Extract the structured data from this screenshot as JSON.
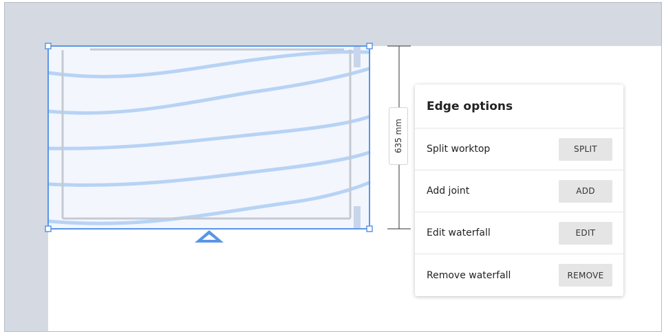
{
  "colors": {
    "wall": "#d5d9e1",
    "selection": "#5a96e6",
    "grain": "#b7d3f5",
    "button_bg": "#e5e5e5"
  },
  "dimension": {
    "label": "635 mm"
  },
  "edge_options": {
    "title": "Edge options",
    "rows": [
      {
        "label": "Split worktop",
        "button": "SPLIT"
      },
      {
        "label": "Add joint",
        "button": "ADD"
      },
      {
        "label": "Edit waterfall",
        "button": "EDIT"
      },
      {
        "label": "Remove waterfall",
        "button": "REMOVE"
      }
    ]
  }
}
